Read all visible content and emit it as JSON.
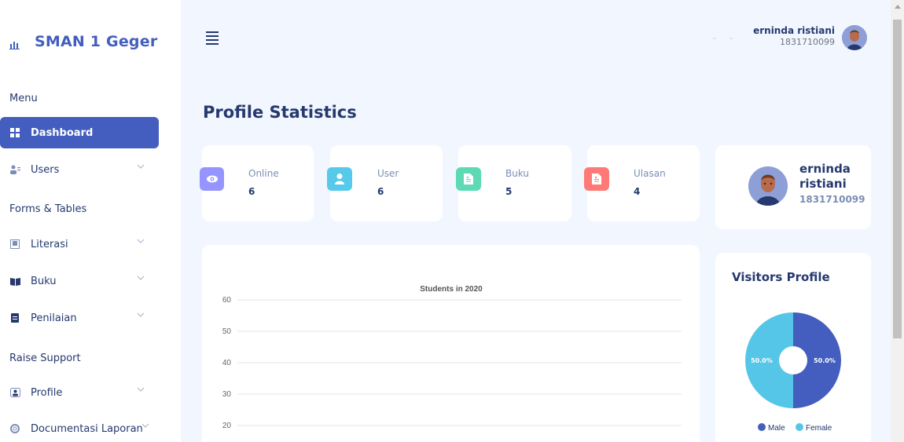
{
  "sidebar": {
    "brand": "SMAN 1 Geger",
    "sections": [
      "Menu",
      "Forms & Tables",
      "Raise Support"
    ],
    "items": [
      {
        "label": "Dashboard",
        "icon": "grid-icon"
      },
      {
        "label": "Users",
        "icon": "users-icon"
      },
      {
        "label": "Literasi",
        "icon": "book-open-icon"
      },
      {
        "label": "Buku",
        "icon": "book-icon"
      },
      {
        "label": "Penilaian",
        "icon": "document-icon"
      },
      {
        "label": "Profile",
        "icon": "profile-icon"
      },
      {
        "label": "Documentasi Laporan",
        "icon": "lifebuoy-icon"
      }
    ]
  },
  "header": {
    "user_name": "erninda ristiani",
    "user_id": "1831710099"
  },
  "main": {
    "title": "Profile Statistics",
    "stats": [
      {
        "label": "Online",
        "value": "6",
        "icon": "eye-icon",
        "color": "#9694ff"
      },
      {
        "label": "User",
        "value": "6",
        "icon": "user-icon",
        "color": "#57caeb"
      },
      {
        "label": "Buku",
        "value": "5",
        "icon": "file-icon",
        "color": "#5ddab4"
      },
      {
        "label": "Ulasan",
        "value": "4",
        "icon": "file-icon",
        "color": "#ff7976"
      }
    ],
    "profile_card": {
      "name": "erninda ristiani",
      "id": "1831710099"
    },
    "visitors_title": "Visitors Profile"
  },
  "chart_data": [
    {
      "type": "line",
      "title": "Students in 2020",
      "y_ticks": [
        "60",
        "50",
        "40",
        "30",
        "20"
      ],
      "ylim": [
        20,
        60
      ],
      "grid": true,
      "series": []
    },
    {
      "type": "pie",
      "labels": [
        "Male",
        "Female"
      ],
      "values": [
        50.0,
        50.0
      ],
      "value_labels": [
        "50.0%",
        "50.0%"
      ],
      "colors": [
        "#435ebe",
        "#55c6e8"
      ],
      "legend": "bottom"
    }
  ],
  "colors": {
    "accent": "#435ebe",
    "text": "#25396f",
    "background": "#f2f7ff"
  }
}
